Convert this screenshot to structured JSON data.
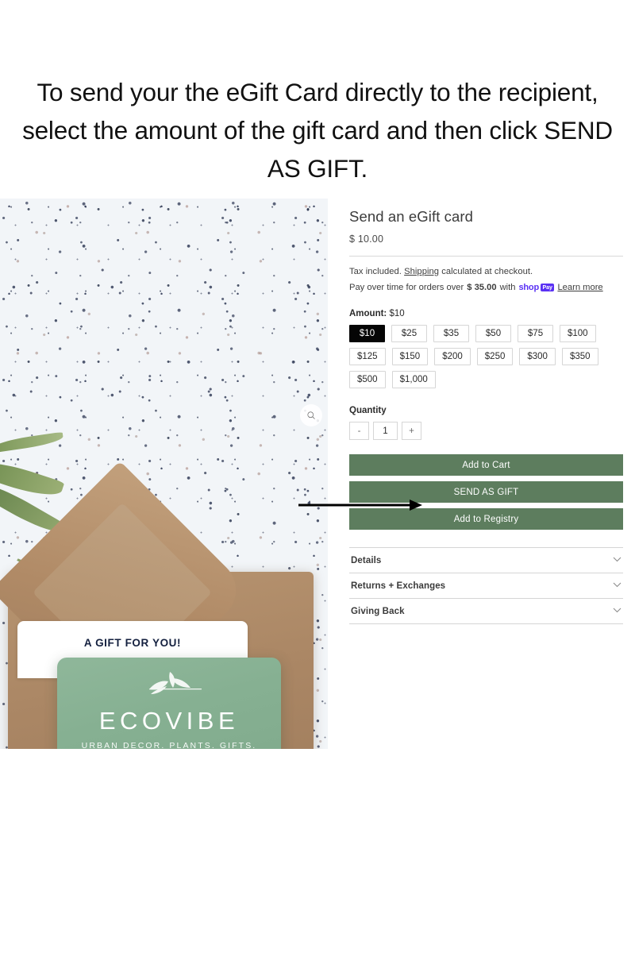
{
  "instruction": {
    "text": "To send your the eGift Card directly to the recipient, select the amount of the gift card and then click SEND AS GIFT."
  },
  "photo": {
    "zoom_icon": "search-icon",
    "insert_text": "A GIFT FOR YOU!",
    "gift_card": {
      "brand": "ECOVIBE",
      "tagline": "URBAN DECOR. PLANTS. GIFTS.",
      "card_color": "#86b092"
    }
  },
  "product": {
    "title": "Send an eGift card",
    "price": "$ 10.00",
    "tax_prefix": "Tax included. ",
    "tax_link": "Shipping",
    "tax_suffix": " calculated at checkout.",
    "pay_prefix": "Pay over time for orders over ",
    "pay_amount": "$ 35.00",
    "pay_with": "with",
    "shop_pay_word": "shop",
    "shop_pay_badge": "Pay",
    "learn_more": "Learn more",
    "amount_label": "Amount:",
    "amount_value": "$10",
    "amounts": [
      "$10",
      "$25",
      "$35",
      "$50",
      "$75",
      "$100",
      "$125",
      "$150",
      "$200",
      "$250",
      "$300",
      "$350",
      "$500",
      "$1,000"
    ],
    "selected_amount": "$10",
    "quantity_label": "Quantity",
    "quantity_decrement": "-",
    "quantity_value": "1",
    "quantity_increment": "+",
    "buttons": {
      "add_to_cart": "Add to Cart",
      "send_as_gift": "SEND AS GIFT",
      "add_to_registry": "Add to Registry",
      "color": "#5d7d5e"
    },
    "accordion": [
      {
        "label": "Details",
        "icon": "chevron-down-icon"
      },
      {
        "label": "Returns + Exchanges",
        "icon": "chevron-down-icon"
      },
      {
        "label": "Giving Back",
        "icon": "chevron-down-icon"
      }
    ]
  },
  "annotation": {
    "arrow": "arrow-right-icon",
    "points_to": "SEND AS GIFT"
  }
}
